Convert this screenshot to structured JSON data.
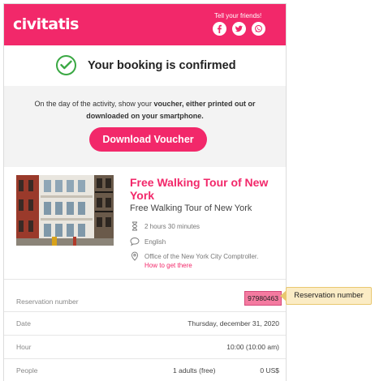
{
  "header": {
    "logo_text": "civitatis",
    "share_text": "Tell your friends!",
    "social_icons": [
      "facebook-icon",
      "twitter-icon",
      "whatsapp-icon"
    ],
    "brand_color": "#f2286a"
  },
  "confirmation": {
    "title": "Your booking is confirmed",
    "icon": "check-circle-icon",
    "icon_color": "#3aa843"
  },
  "instructions": {
    "text_prefix": "On the day of the activity, show your ",
    "text_bold": "voucher, either printed out or downloaded on your smartphone.",
    "download_button": "Download Voucher"
  },
  "tour": {
    "title": "Free Walking Tour of New York",
    "subtitle": "Free Walking Tour of New York",
    "duration": "2 hours 30 minutes",
    "language": "English",
    "meeting_point": "Office of the New York City Comptroller.",
    "directions_link": "How to get there"
  },
  "details": {
    "reservation_label": "Reservation number",
    "reservation_value": "97980463",
    "date_label": "Date",
    "date_value": "Thursday, december 31, 2020",
    "hour_label": "Hour",
    "hour_value": "10:00 (10:00 am)",
    "people_label": "People",
    "people_quantity": "1 adults (free)",
    "people_price": "0 US$"
  },
  "annotation": {
    "callout_text": "Reservation number",
    "highlight_color": "#f47aa0",
    "callout_color": "#fbecc5"
  }
}
